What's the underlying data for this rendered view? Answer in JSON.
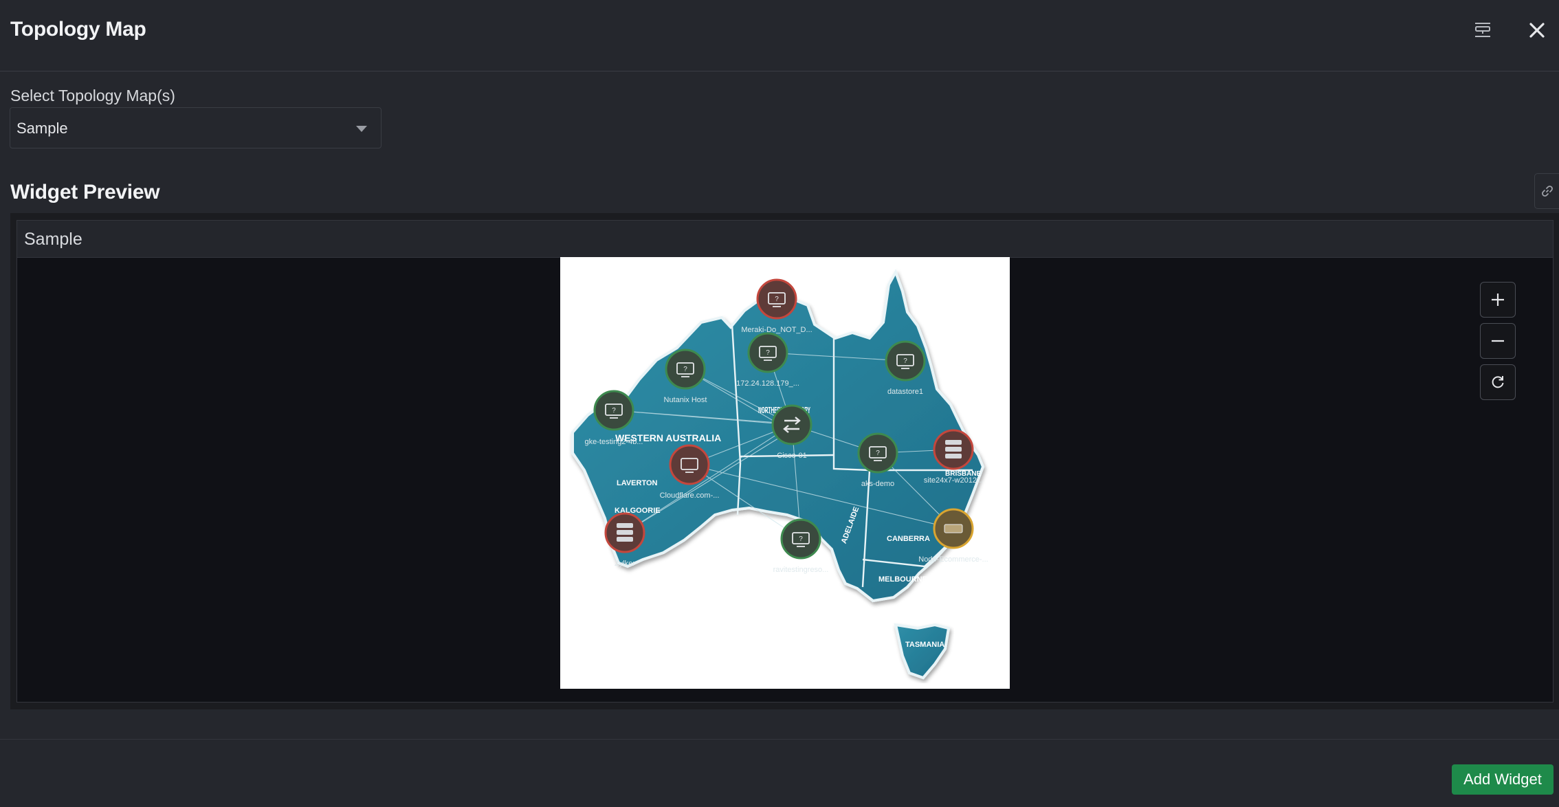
{
  "header": {
    "title": "Topology Map"
  },
  "form": {
    "select_label": "Select Topology Map(s)",
    "selected_map": "Sample"
  },
  "preview": {
    "section_title": "Widget Preview",
    "widget_title": "Sample"
  },
  "map": {
    "regions": [
      "WESTERN AUSTRALIA",
      "NORTHERN TERRITORY",
      "LAVERTON",
      "KALGOORIE",
      "ADELAIDE",
      "BRISBANE",
      "CANBERRA",
      "MELBOURNE",
      "TASMANIA"
    ],
    "nodes": [
      {
        "label": "Meraki-Do_NOT_D...",
        "status": "down",
        "icon": "monitor-icon"
      },
      {
        "label": "172.24.128.179_...",
        "status": "up",
        "icon": "monitor-icon"
      },
      {
        "label": "Nutanix Host",
        "status": "up",
        "icon": "monitor-icon"
      },
      {
        "label": "datastore1",
        "status": "up",
        "icon": "monitor-icon"
      },
      {
        "label": "gke-testing2-4b...",
        "status": "up",
        "icon": "monitor-icon"
      },
      {
        "label": "Cisco-01",
        "status": "up",
        "icon": "switch-icon"
      },
      {
        "label": "Cloudflare.com-...",
        "status": "down",
        "icon": "monitor-icon"
      },
      {
        "label": "aks-demo",
        "status": "up",
        "icon": "monitor-icon"
      },
      {
        "label": "site24x7-w2012...",
        "status": "down",
        "icon": "server-icon"
      },
      {
        "label": "Zylker",
        "status": "down",
        "icon": "server-icon"
      },
      {
        "label": "ravitestingreso...",
        "status": "up",
        "icon": "monitor-icon"
      },
      {
        "label": "Node-Ecommerce-...",
        "status": "trouble",
        "icon": "device-icon"
      }
    ]
  },
  "footer": {
    "add_label": "Add Widget"
  },
  "colors": {
    "up": "#3e8a4f",
    "down": "#c4473d",
    "trouble": "#d9a531",
    "accent": "#1e8a4a",
    "ocean_map": "#3a8fa6"
  }
}
